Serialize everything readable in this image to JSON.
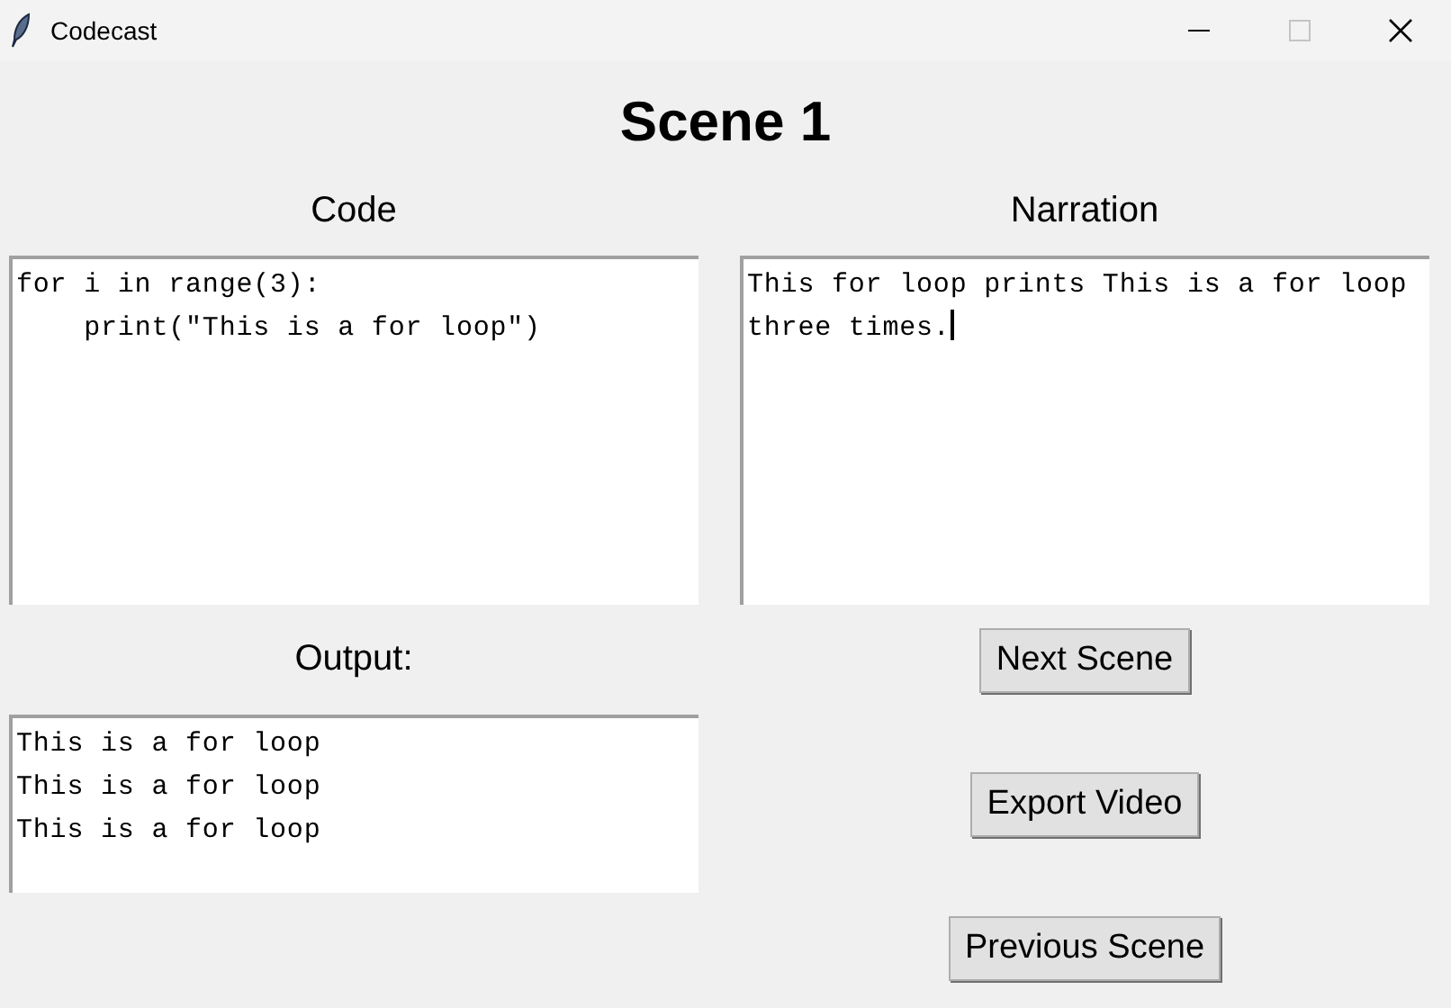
{
  "window": {
    "title": "Codecast"
  },
  "heading": "Scene 1",
  "code": {
    "label": "Code",
    "text": "for i in range(3):\n    print(\"This is a for loop\")"
  },
  "narration": {
    "label": "Narration",
    "text": "This for loop prints This is a for loop three times.",
    "focused": true
  },
  "output": {
    "label": "Output:",
    "text": "This is a for loop\nThis is a for loop\nThis is a for loop"
  },
  "buttons": [
    "Next Scene",
    "Export Video",
    "Previous Scene"
  ]
}
